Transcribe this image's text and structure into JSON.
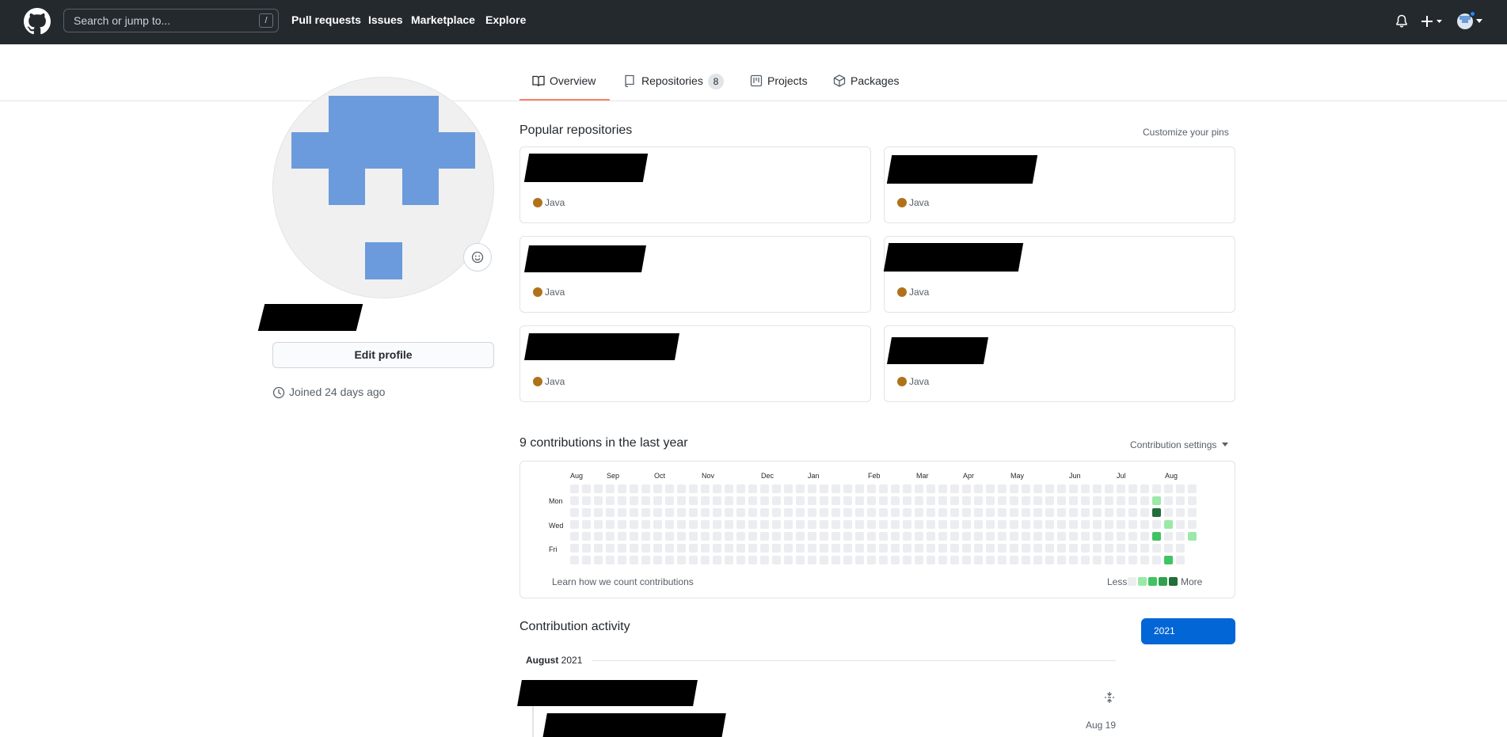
{
  "header": {
    "search_placeholder": "Search or jump to...",
    "search_key": "/",
    "nav": [
      "Pull requests",
      "Issues",
      "Marketplace",
      "Explore"
    ]
  },
  "tabs": {
    "overview": "Overview",
    "repositories": "Repositories",
    "repositories_count": "8",
    "projects": "Projects",
    "packages": "Packages"
  },
  "sidebar": {
    "edit_profile": "Edit profile",
    "joined": "Joined 24 days ago"
  },
  "popular": {
    "title": "Popular repositories",
    "customize": "Customize your pins",
    "repos": [
      {
        "language": "Java"
      },
      {
        "language": "Java"
      },
      {
        "language": "Java"
      },
      {
        "language": "Java"
      },
      {
        "language": "Java"
      },
      {
        "language": "Java"
      }
    ],
    "language_color": "#b07219"
  },
  "contributions": {
    "title": "9 contributions in the last year",
    "settings": "Contribution settings",
    "months": [
      "Aug",
      "Sep",
      "Oct",
      "Nov",
      "Dec",
      "Jan",
      "Feb",
      "Mar",
      "Apr",
      "May",
      "Jun",
      "Jul",
      "Aug"
    ],
    "days": [
      "Mon",
      "Wed",
      "Fri"
    ],
    "learn": "Learn how we count contributions",
    "less": "Less",
    "more": "More",
    "legend_colors": [
      "#ebedf0",
      "#9be9a8",
      "#40c463",
      "#30a14e",
      "#216e39"
    ]
  },
  "activity": {
    "title": "Contribution activity",
    "year": "2021",
    "month_label": "August",
    "month_year": "2021",
    "date": "Aug 19"
  }
}
